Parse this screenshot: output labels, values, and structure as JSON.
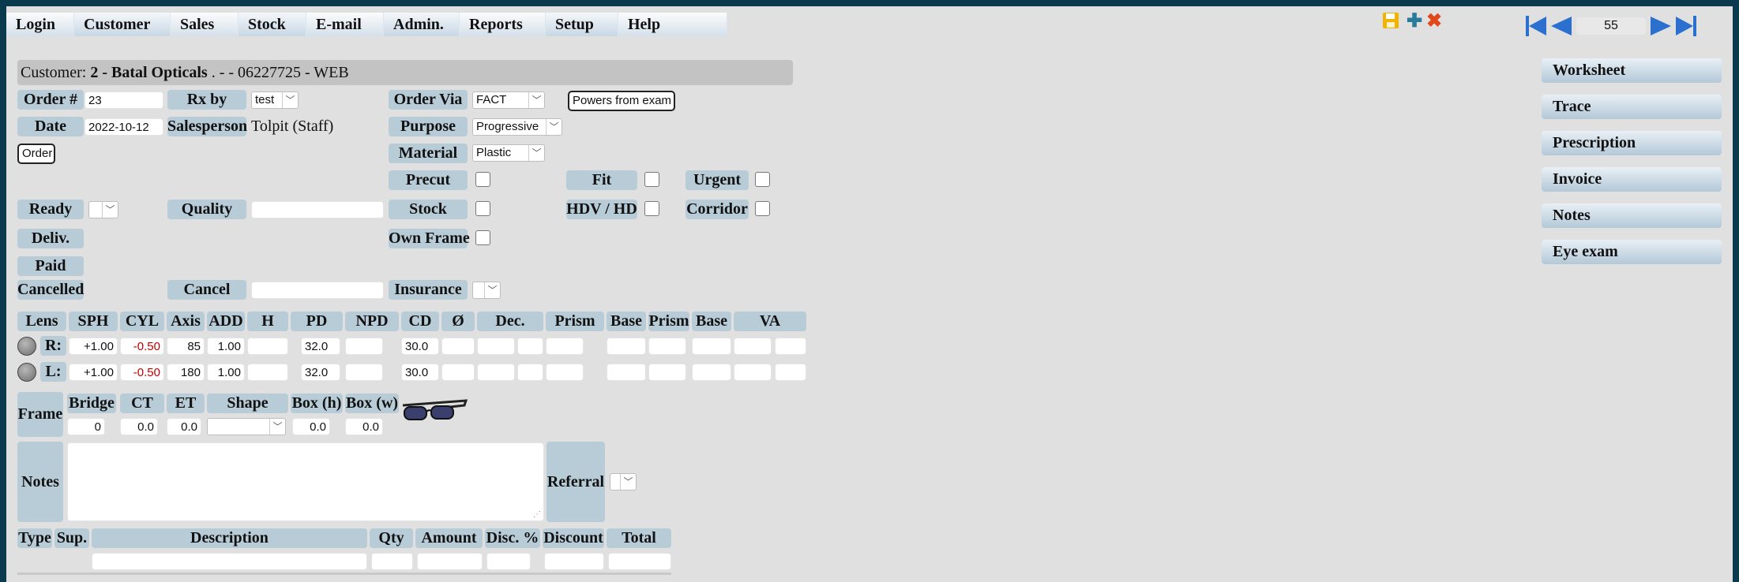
{
  "menu": {
    "items": [
      "Login",
      "Customer",
      "Sales",
      "Stock",
      "E-mail",
      "Admin.",
      "Reports",
      "Setup",
      "Help"
    ]
  },
  "pager": {
    "page": "55"
  },
  "icons": {
    "save": "save-icon",
    "add": "add-icon",
    "delete": "delete-icon",
    "first": "first-page-icon",
    "prev": "prev-page-icon",
    "next": "next-page-icon",
    "last": "last-page-icon",
    "glasses": "glasses-icon"
  },
  "customer": {
    "prefix": "Customer: ",
    "name": "2 - Batal Opticals",
    "suffix": " . - - 06227725 - WEB"
  },
  "order": {
    "order_no_label": "Order #",
    "order_no": "23",
    "rx_by_label": "Rx by",
    "rx_by": "test",
    "order_via_label": "Order Via",
    "order_via": "FACT",
    "powers_button": "Powers from exam",
    "date_label": "Date",
    "date": "2022-10-12",
    "salesperson_label": "Salesperson",
    "salesperson": "Tolpit (Staff)",
    "purpose_label": "Purpose",
    "purpose": "Progressive",
    "order_button": "Order",
    "material_label": "Material",
    "material": "Plastic",
    "precut_label": "Precut",
    "fit_label": "Fit",
    "urgent_label": "Urgent",
    "ready_label": "Ready",
    "quality_label": "Quality",
    "quality": "",
    "stock_label": "Stock",
    "hdv_label": "HDV / HD",
    "corridor_label": "Corridor",
    "deliv_label": "Deliv.",
    "own_frame_label": "Own Frame",
    "paid_label": "Paid",
    "cancelled_label": "Cancelled",
    "cancel_label": "Cancel",
    "cancel": "",
    "insurance_label": "Insurance"
  },
  "lens": {
    "headers": [
      "Lens",
      "SPH",
      "CYL",
      "Axis",
      "ADD",
      "H",
      "PD",
      "NPD",
      "CD",
      "Ø",
      "Dec.",
      "Prism",
      "Base",
      "Prism",
      "Base",
      "VA"
    ],
    "right": {
      "label": "R:",
      "sph": "+1.00",
      "cyl": "-0.50",
      "axis": "85",
      "add": "1.00",
      "pd": "32.0",
      "cd": "30.0"
    },
    "left": {
      "label": "L:",
      "sph": "+1.00",
      "cyl": "-0.50",
      "axis": "180",
      "add": "1.00",
      "pd": "32.0",
      "cd": "30.0"
    }
  },
  "frame": {
    "label": "Frame",
    "headers": [
      "Bridge",
      "CT",
      "ET",
      "Shape",
      "Box (h)",
      "Box (w)"
    ],
    "bridge": "0",
    "ct": "0.0",
    "et": "0.0",
    "box_h": "0.0",
    "box_w": "0.0"
  },
  "notes": {
    "label": "Notes",
    "referral_label": "Referral"
  },
  "items": {
    "headers": [
      "Type",
      "Sup.",
      "Description",
      "Qty",
      "Amount",
      "Disc. %",
      "Discount",
      "Total"
    ]
  },
  "sidebar": {
    "items": [
      "Worksheet",
      "Trace",
      "Prescription",
      "Invoice",
      "Notes",
      "Eye exam"
    ]
  },
  "colors": {
    "label_bg": "#b8ccd7",
    "red_value": "#c00000",
    "background": "#e0e0e0"
  }
}
